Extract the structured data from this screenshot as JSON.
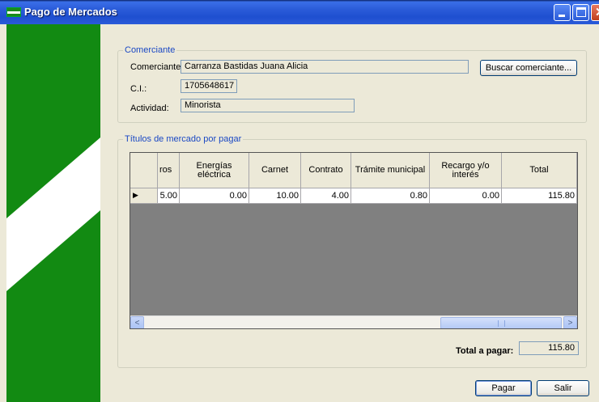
{
  "window": {
    "title": "Pago de Mercados"
  },
  "comerciante": {
    "group_title": "Comerciante",
    "label_nombre": "Comerciante:",
    "nombre": "Carranza Bastidas Juana Alicia",
    "label_ci": "C.I.:",
    "ci": "1705648617",
    "label_actividad": "Actividad:",
    "actividad": "Minorista",
    "buscar_button": "Buscar comerciante..."
  },
  "titulos": {
    "group_title": "Títulos de mercado por pagar",
    "columns": [
      "ros",
      "Energías eléctrica",
      "Carnet",
      "Contrato",
      "Trámite municipal",
      "Recargo y/o interés",
      "Total"
    ],
    "rows": [
      {
        "row_marker": "▶",
        "cells": [
          "5.00",
          "0.00",
          "10.00",
          "4.00",
          "0.80",
          "0.00",
          "115.80"
        ]
      }
    ],
    "scroll_left": "<",
    "scroll_right": ">"
  },
  "total": {
    "label": "Total a pagar:",
    "value": "115.80"
  },
  "buttons": {
    "pagar": "Pagar",
    "salir": "Salir"
  },
  "colors": {
    "titlebar": "#2A5BD8",
    "flag_green": "#128A12",
    "group_title": "#1A48C4",
    "window_bg": "#ECE9D8"
  }
}
